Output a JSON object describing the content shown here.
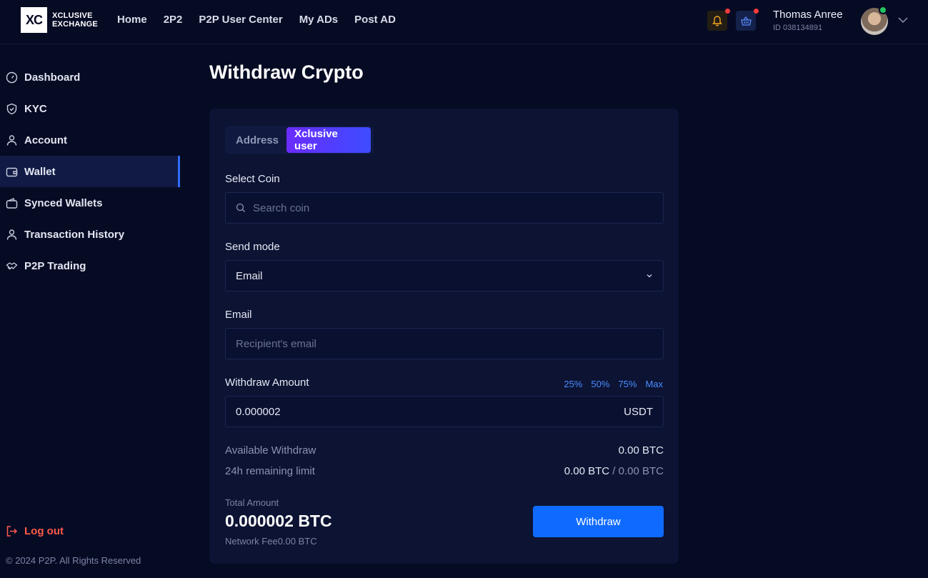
{
  "header": {
    "logo_mark": "XC",
    "logo_line1": "XCLUSIVE",
    "logo_line2": "EXCHANGE",
    "nav": [
      "Home",
      "2P2",
      "P2P User Center",
      "My ADs",
      "Post AD"
    ],
    "user_name": "Thomas Anree",
    "user_id": "ID 038134891"
  },
  "sidebar": {
    "items": [
      {
        "label": "Dashboard",
        "icon": "gauge-icon"
      },
      {
        "label": "KYC",
        "icon": "shield-icon"
      },
      {
        "label": "Account",
        "icon": "user-icon"
      },
      {
        "label": "Wallet",
        "icon": "wallet-icon"
      },
      {
        "label": "Synced Wallets",
        "icon": "wallet-sync-icon"
      },
      {
        "label": "Transaction History",
        "icon": "user-icon"
      },
      {
        "label": "P2P Trading",
        "icon": "handshake-icon"
      }
    ],
    "active": "Wallet",
    "logout_label": "Log out",
    "copyright": "© 2024 P2P. All Rights Reserved"
  },
  "main": {
    "title": "Withdraw Crypto",
    "tabs": [
      "Address",
      "Xclusive user"
    ],
    "active_tab": "Xclusive user",
    "select_coin_label": "Select Coin",
    "search_placeholder": "Search coin",
    "send_mode_label": "Send mode",
    "send_mode_value": "Email",
    "email_label": "Email",
    "email_placeholder": "Recipient's email",
    "amount_label": "Withdraw Amount",
    "percent_options": [
      "25%",
      "50%",
      "75%",
      "Max"
    ],
    "amount_value": "0.000002",
    "amount_unit": "USDT",
    "available_label": "Available Withdraw",
    "available_value": "0.00 BTC",
    "limit_label": "24h remaining limit",
    "limit_used": "0.00 BTC",
    "limit_sep": "/",
    "limit_total": "0.00 BTC",
    "total_label": "Total Amount",
    "total_value": "0.000002 BTC",
    "fee_text": "Network Fee0.00 BTC",
    "withdraw_label": "Withdraw"
  },
  "colors": {
    "background": "#060b24",
    "card": "#0c1333",
    "accent": "#0f6bff",
    "tab_gradient_start": "#6a2cff",
    "logout": "#ff5a4a",
    "notification_dot": "#ff3b3b"
  }
}
